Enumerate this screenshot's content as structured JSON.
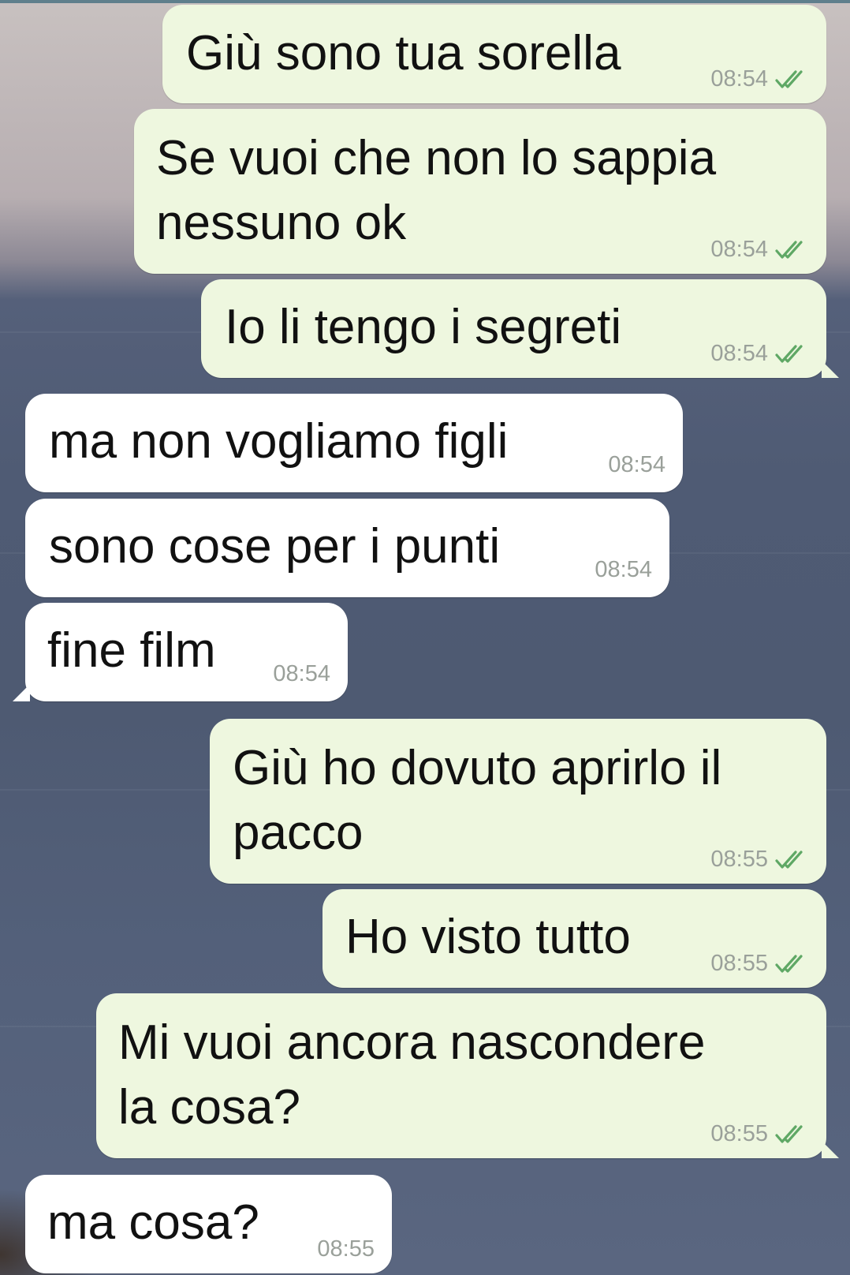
{
  "messages": [
    {
      "direction": "outgoing",
      "text": "Giù sono tua sorella",
      "time": "08:54",
      "status_icon": "double-check-icon"
    },
    {
      "direction": "outgoing",
      "text": "Se vuoi che non lo sappia\nnessuno ok",
      "time": "08:54",
      "status_icon": "double-check-icon"
    },
    {
      "direction": "outgoing",
      "text": "Io li tengo i segreti",
      "time": "08:54",
      "status_icon": "double-check-icon"
    },
    {
      "direction": "incoming",
      "text": "ma non vogliamo figli",
      "time": "08:54"
    },
    {
      "direction": "incoming",
      "text": "sono cose per i punti",
      "time": "08:54"
    },
    {
      "direction": "incoming",
      "text": "fine film",
      "time": "08:54"
    },
    {
      "direction": "outgoing",
      "text": "Giù ho dovuto aprirlo il\npacco",
      "time": "08:55",
      "status_icon": "double-check-icon"
    },
    {
      "direction": "outgoing",
      "text": "Ho visto tutto",
      "time": "08:55",
      "status_icon": "double-check-icon"
    },
    {
      "direction": "outgoing",
      "text": "Mi vuoi ancora nascondere\nla cosa?",
      "time": "08:55",
      "status_icon": "double-check-icon"
    },
    {
      "direction": "incoming",
      "text": "ma cosa?",
      "time": "08:55"
    }
  ],
  "colors": {
    "outgoing_bubble": "#eef7df",
    "incoming_bubble": "#ffffff",
    "read_tick": "#5fa865",
    "timestamp": "#9aa09a"
  }
}
